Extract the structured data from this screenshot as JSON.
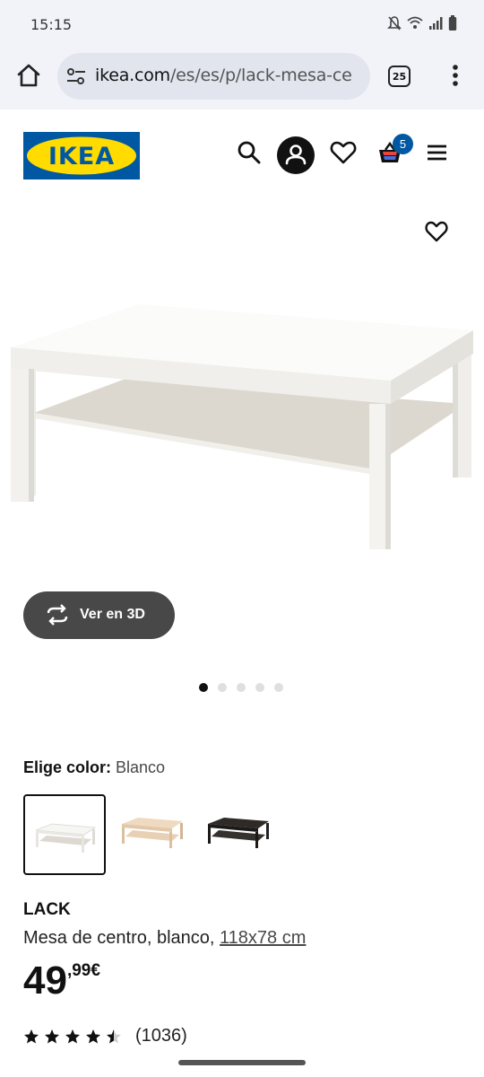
{
  "status_bar": {
    "time": "15:15"
  },
  "browser": {
    "url_host": "ikea.com",
    "url_path": "/es/es/p/lack-mesa-ce",
    "tab_count": "25"
  },
  "header": {
    "logo_text": "IKEA",
    "cart_count": "5"
  },
  "product": {
    "view3d_label": "Ver en 3D",
    "gallery_dots": 5,
    "gallery_active": 0,
    "color_label": "Elige color:",
    "color_value": "Blanco",
    "swatches": [
      "blanco",
      "efecto roble tinte blanco",
      "negro-marrón"
    ],
    "name": "LACK",
    "description": "Mesa de centro, blanco,",
    "dimensions": "118x78 cm",
    "price_int": "49",
    "price_dec": ",99",
    "currency": "€",
    "rating_value": 4.5,
    "rating_count": "(1036)"
  },
  "colors": {
    "brand_blue": "#0058a3",
    "brand_yellow": "#ffdb00",
    "button_dark": "#484848"
  }
}
